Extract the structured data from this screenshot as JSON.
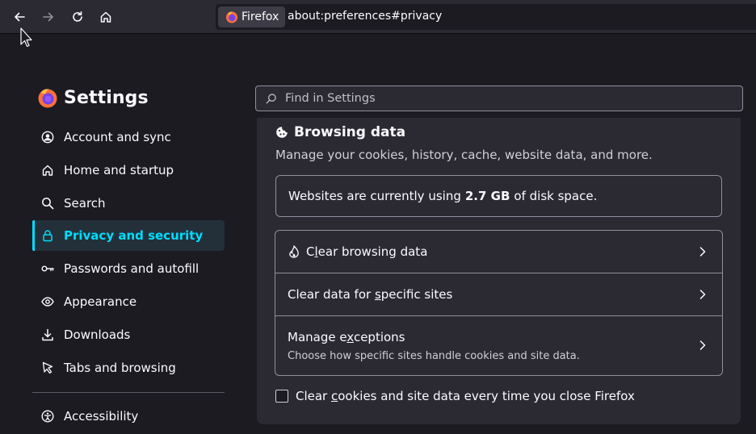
{
  "browser": {
    "identity_label": "Firefox",
    "url": "about:preferences#privacy"
  },
  "sidebar": {
    "title": "Settings",
    "items": [
      {
        "label": "Account and sync",
        "icon": "account-icon"
      },
      {
        "label": "Home and startup",
        "icon": "home-icon"
      },
      {
        "label": "Search",
        "icon": "search-icon"
      },
      {
        "label": "Privacy and security",
        "icon": "lock-icon",
        "selected": true
      },
      {
        "label": "Passwords and autofill",
        "icon": "key-icon"
      },
      {
        "label": "Appearance",
        "icon": "eye-icon"
      },
      {
        "label": "Downloads",
        "icon": "download-icon"
      },
      {
        "label": "Tabs and browsing",
        "icon": "cursor-icon"
      }
    ],
    "accessibility_label": "Accessibility"
  },
  "search": {
    "placeholder": "Find in Settings"
  },
  "browsing_data": {
    "title": "Browsing data",
    "description": "Manage your cookies, history, cache, website data, and more.",
    "disk_usage_prefix": "Websites are currently using",
    "disk_usage_value": "2.7 GB",
    "disk_usage_suffix": "of disk space.",
    "rows": {
      "clear_browsing_pre": "C",
      "clear_browsing_key": "l",
      "clear_browsing_post": "ear browsing data",
      "clear_sites_pre": "Clear data for ",
      "clear_sites_key": "s",
      "clear_sites_post": "pecific sites",
      "exceptions_pre": "Manage e",
      "exceptions_key": "x",
      "exceptions_post": "ceptions",
      "exceptions_sub": "Choose how specific sites handle cookies and site data."
    },
    "checkbox": {
      "pre": "Clear ",
      "key": "c",
      "post": "ookies and site data every time you close Firefox",
      "checked": false
    }
  },
  "colors": {
    "accent": "#00ddff",
    "background": "#1c1b22",
    "card": "#2b2a33"
  }
}
